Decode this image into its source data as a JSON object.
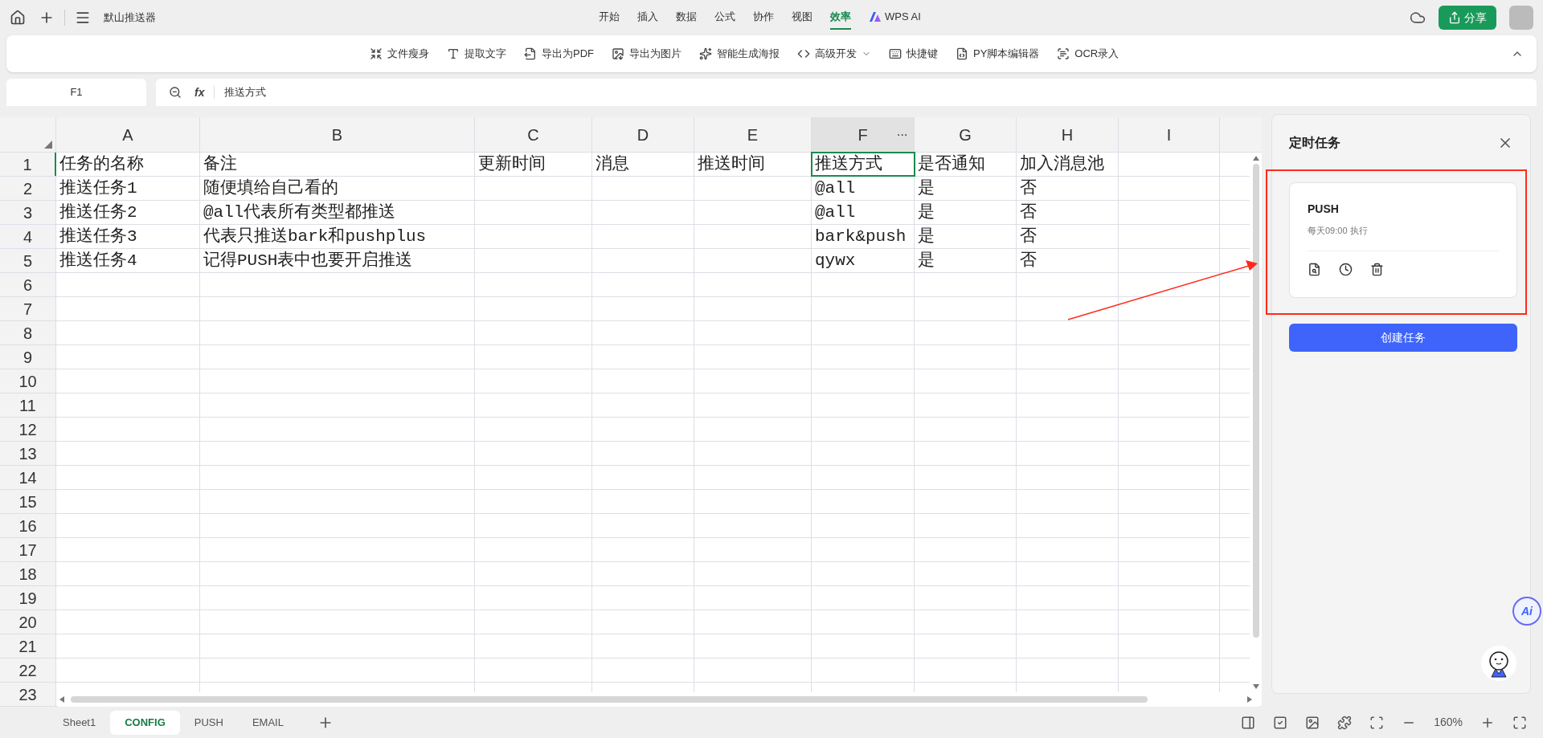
{
  "app": {
    "title": "默山推送器"
  },
  "menu_tabs": [
    {
      "label": "开始",
      "selected": false
    },
    {
      "label": "插入",
      "selected": false
    },
    {
      "label": "数据",
      "selected": false
    },
    {
      "label": "公式",
      "selected": false
    },
    {
      "label": "协作",
      "selected": false
    },
    {
      "label": "视图",
      "selected": false
    },
    {
      "label": "效率",
      "selected": true
    },
    {
      "label": "WPS AI",
      "selected": false
    }
  ],
  "share_button": "分享",
  "toolbar": [
    {
      "label": "文件瘦身",
      "dropdown": false
    },
    {
      "label": "提取文字",
      "dropdown": false
    },
    {
      "label": "导出为PDF",
      "dropdown": false
    },
    {
      "label": "导出为图片",
      "dropdown": false
    },
    {
      "label": "智能生成海报",
      "dropdown": false
    },
    {
      "label": "高级开发",
      "dropdown": true
    },
    {
      "label": "快捷键",
      "dropdown": false
    },
    {
      "label": "PY脚本编辑器",
      "dropdown": false
    },
    {
      "label": "OCR录入",
      "dropdown": false
    }
  ],
  "column_menu": "···",
  "name_box": "F1",
  "fx_label": "fx",
  "formula": "推送方式",
  "columns": [
    {
      "label": "A",
      "selected": false
    },
    {
      "label": "B",
      "selected": false
    },
    {
      "label": "C",
      "selected": false
    },
    {
      "label": "D",
      "selected": false
    },
    {
      "label": "E",
      "selected": false
    },
    {
      "label": "F",
      "selected": true
    },
    {
      "label": "G",
      "selected": false
    },
    {
      "label": "H",
      "selected": false
    },
    {
      "label": "I",
      "selected": false
    }
  ],
  "rows": [
    {
      "number": "1",
      "selected": true,
      "cells": {
        "A": "任务的名称",
        "B": "备注",
        "C": "更新时间",
        "D": "消息",
        "E": "推送时间",
        "F": "推送方式",
        "G": "是否通知",
        "H": "加入消息池"
      }
    },
    {
      "number": "2",
      "selected": false,
      "cells": {
        "A": "推送任务1",
        "B": "随便填给自己看的",
        "F": "@all",
        "G": "是",
        "H": "否"
      }
    },
    {
      "number": "3",
      "selected": false,
      "cells": {
        "A": "推送任务2",
        "B": "@all代表所有类型都推送",
        "F": "@all",
        "G": "是",
        "H": "否"
      }
    },
    {
      "number": "4",
      "selected": false,
      "cells": {
        "A": "推送任务3",
        "B": "代表只推送bark和pushplus",
        "F": "bark&push",
        "G": "是",
        "H": "否"
      }
    },
    {
      "number": "5",
      "selected": false,
      "cells": {
        "A": "推送任务4",
        "B": "记得PUSH表中也要开启推送",
        "F": "qywx",
        "G": "是",
        "H": "否"
      }
    },
    {
      "number": "6",
      "selected": false
    },
    {
      "number": "7",
      "selected": false
    },
    {
      "number": "8",
      "selected": false
    },
    {
      "number": "9",
      "selected": false
    },
    {
      "number": "10",
      "selected": false
    },
    {
      "number": "11",
      "selected": false
    },
    {
      "number": "12",
      "selected": false
    },
    {
      "number": "13",
      "selected": false
    },
    {
      "number": "14",
      "selected": false
    },
    {
      "number": "15",
      "selected": false
    },
    {
      "number": "16",
      "selected": false
    },
    {
      "number": "17",
      "selected": false
    },
    {
      "number": "18",
      "selected": false
    },
    {
      "number": "19",
      "selected": false
    },
    {
      "number": "20",
      "selected": false
    },
    {
      "number": "21",
      "selected": false
    },
    {
      "number": "22",
      "selected": false
    },
    {
      "number": "23",
      "selected": false
    }
  ],
  "panel": {
    "title": "定时任务",
    "tasks": [
      {
        "name": "PUSH",
        "schedule": "每天09:00 执行"
      }
    ],
    "create_button": "创建任务"
  },
  "ai_button": "Ai",
  "sheet_tabs": [
    {
      "label": "Sheet1",
      "selected": false
    },
    {
      "label": "CONFIG",
      "selected": true
    },
    {
      "label": "PUSH",
      "selected": false
    },
    {
      "label": "EMAIL",
      "selected": false
    }
  ],
  "zoom": "160%"
}
